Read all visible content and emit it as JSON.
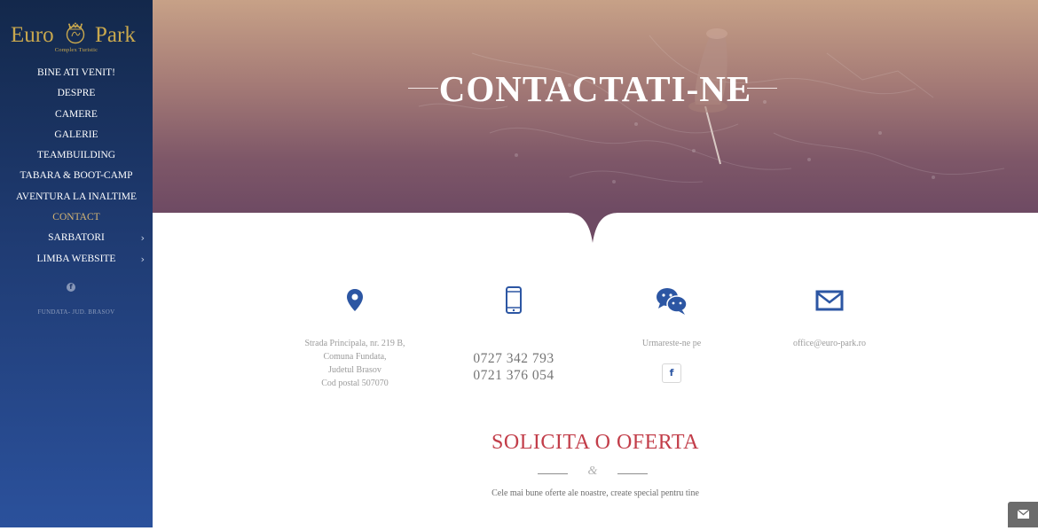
{
  "brand": {
    "word1": "Euro",
    "word2": "Park",
    "tagline": "Complex Turistic",
    "color": "#c9a84e"
  },
  "nav": {
    "items": [
      {
        "label": "BINE ATI VENIT!",
        "active": false
      },
      {
        "label": "DESPRE",
        "active": false
      },
      {
        "label": "CAMERE",
        "active": false
      },
      {
        "label": "GALERIE",
        "active": false
      },
      {
        "label": "TEAMBUILDING",
        "active": false
      },
      {
        "label": "TABARA & BOOT-CAMP",
        "active": false
      },
      {
        "label": "AVENTURA LA INALTIME",
        "active": false
      },
      {
        "label": "CONTACT",
        "active": true
      },
      {
        "label": "SARBATORI",
        "active": false,
        "submenu": true
      },
      {
        "label": "LIMBA WEBSITE",
        "active": false,
        "submenu": true
      }
    ],
    "submenu_glyph": "›",
    "active_color": "#d7b673"
  },
  "sidebar": {
    "facebook_icon": "f",
    "address": "FUNDATA- JUD. BRASOV"
  },
  "hero": {
    "title": "CONTACTATI-NE"
  },
  "contact": {
    "address_lines": [
      "Strada Principala, nr. 219 B,",
      "Comuna Fundata,",
      "Judetul Brasov",
      "Cod postal 507070"
    ],
    "phones": [
      "0727 342 793",
      "0721 376 054"
    ],
    "follow_text": "Urmareste-ne pe",
    "facebook_icon": "f",
    "email": "office@euro-park.ro",
    "icons": [
      "location-pin-icon",
      "mobile-phone-icon",
      "chat-bubbles-icon",
      "envelope-icon"
    ],
    "icon_color": "#2c56a3"
  },
  "offer": {
    "title": "SOLICITA O OFERTA",
    "divider_glyph": "&",
    "subtitle": "Cele mai bune oferte ale noastre, create special pentru tine",
    "title_color": "#c23d49"
  }
}
